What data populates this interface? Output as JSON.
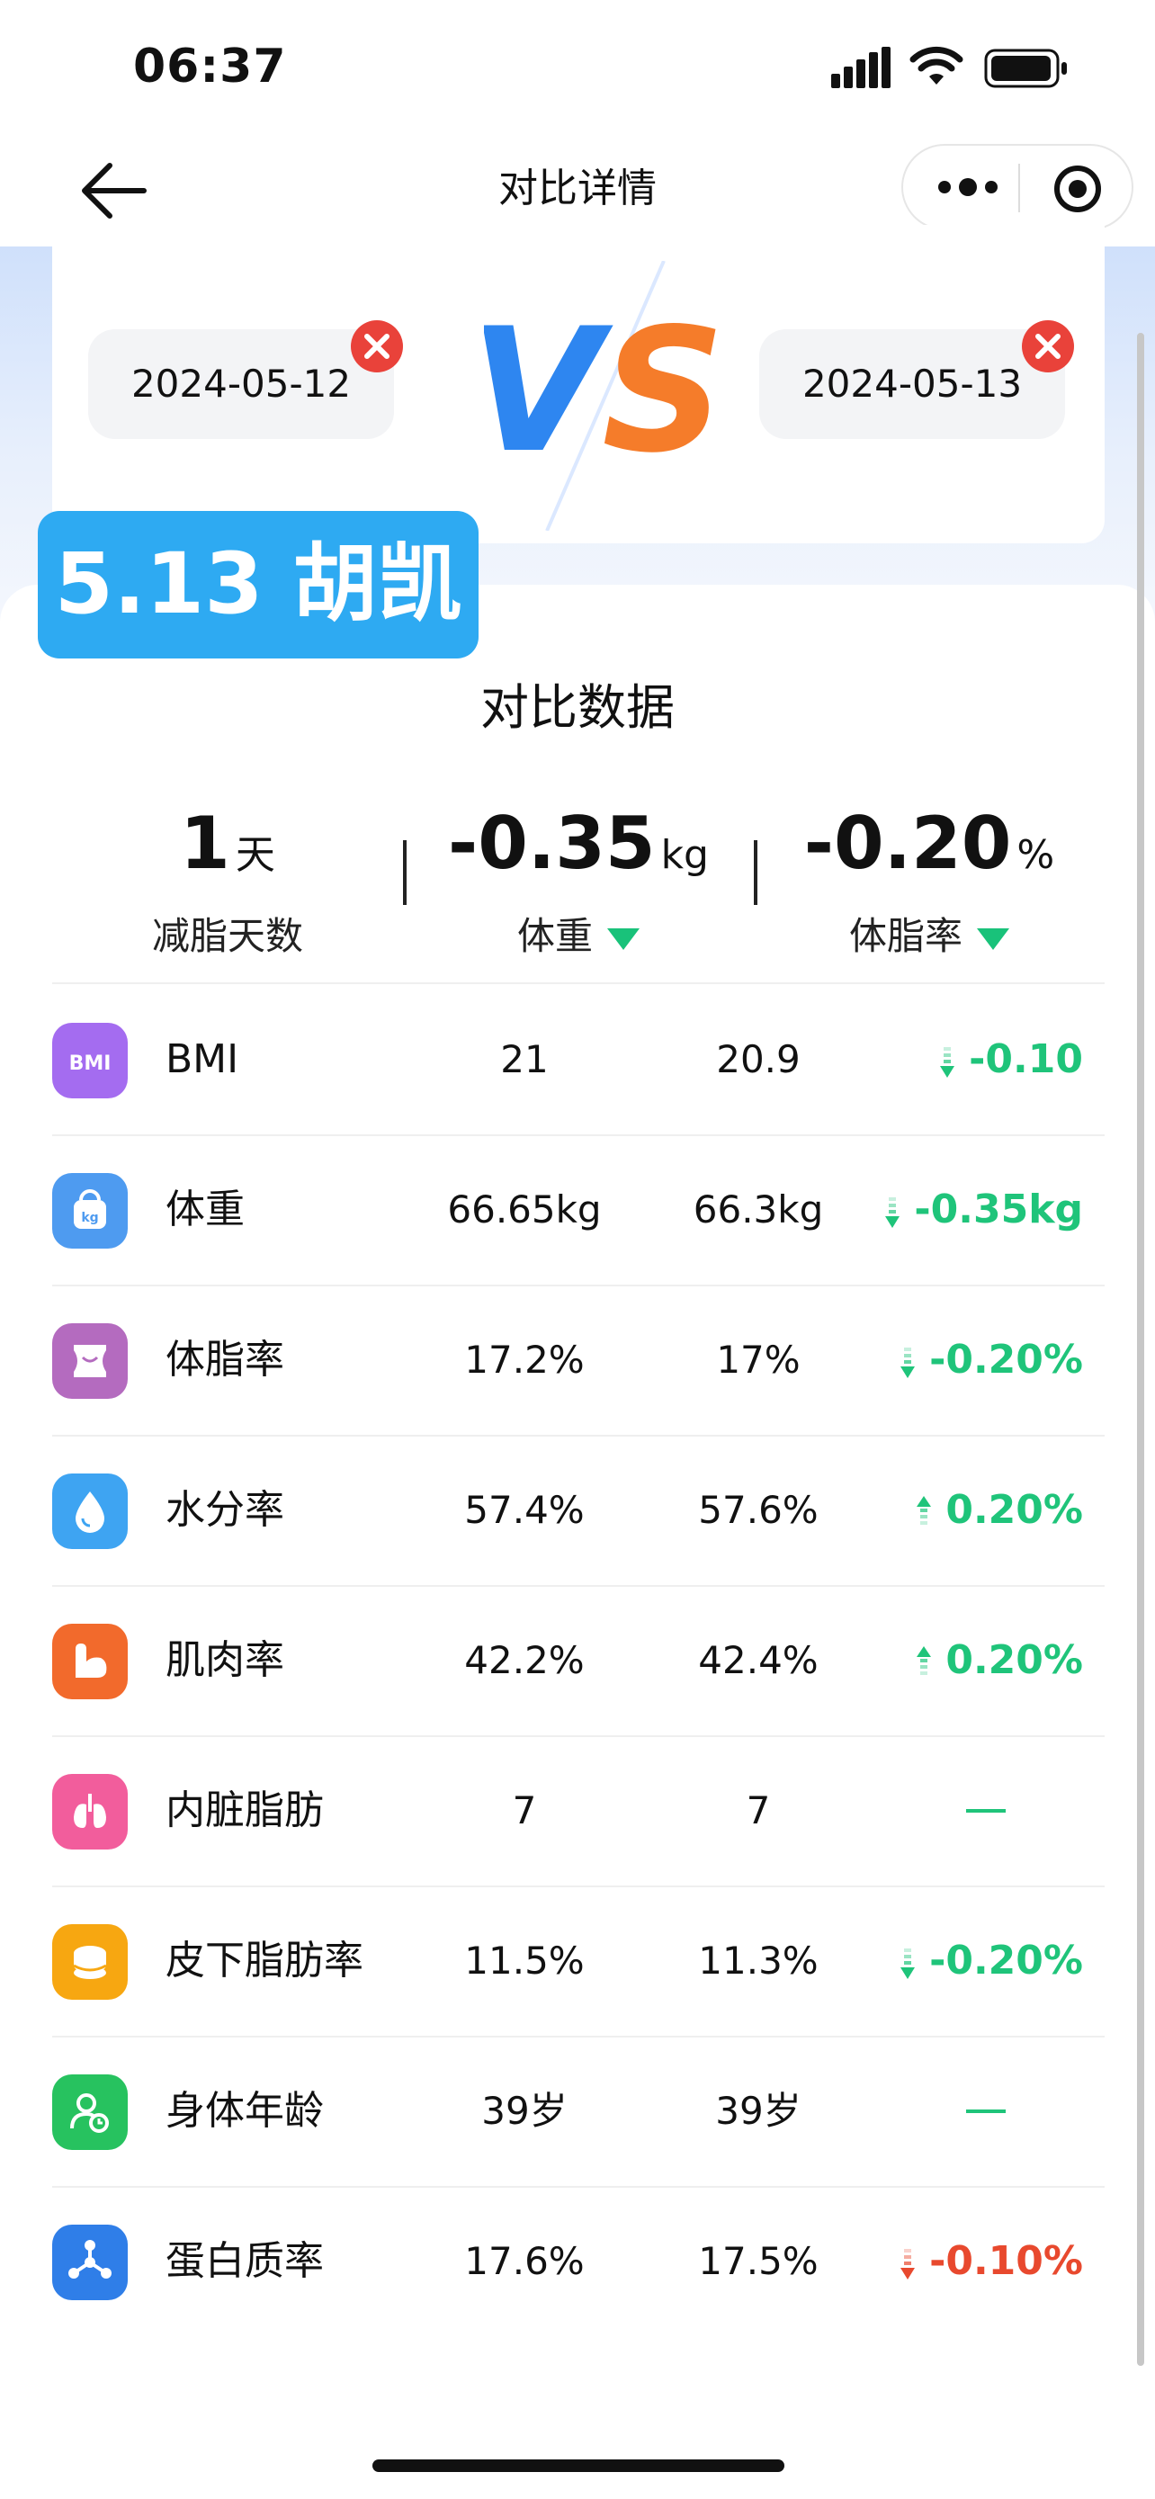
{
  "status_bar": {
    "time": "06:37"
  },
  "nav": {
    "title": "对比详情"
  },
  "compare": {
    "date_left": "2024-05-12",
    "date_right": "2024-05-13",
    "vs_text": "VS"
  },
  "overlay_tag": "5.13 胡凯",
  "section_title": "对比数据",
  "summary": [
    {
      "value": "1",
      "unit": "天",
      "label": "减脂天数",
      "trend": ""
    },
    {
      "value": "-0.35",
      "unit": "kg",
      "label": "体重",
      "trend": "down"
    },
    {
      "value": "-0.20",
      "unit": "%",
      "label": "体脂率",
      "trend": "down"
    }
  ],
  "rows": [
    {
      "icon": "bmi-icon",
      "color": "#a46cf0",
      "name": "BMI",
      "v1": "21",
      "v2": "20.9",
      "diff": "-0.10",
      "trend": "down",
      "diff_color": "green"
    },
    {
      "icon": "weight-kg-icon",
      "color": "#4e9bf0",
      "name": "体重",
      "v1": "66.65kg",
      "v2": "66.3kg",
      "diff": "-0.35kg",
      "trend": "down",
      "diff_color": "green"
    },
    {
      "icon": "body-fat-icon",
      "color": "#b46bbf",
      "name": "体脂率",
      "v1": "17.2%",
      "v2": "17%",
      "diff": "-0.20%",
      "trend": "down",
      "diff_color": "green"
    },
    {
      "icon": "water-drop-icon",
      "color": "#3ea4f2",
      "name": "水分率",
      "v1": "57.4%",
      "v2": "57.6%",
      "diff": "0.20%",
      "trend": "up",
      "diff_color": "green"
    },
    {
      "icon": "muscle-icon",
      "color": "#f26a2c",
      "name": "肌肉率",
      "v1": "42.2%",
      "v2": "42.4%",
      "diff": "0.20%",
      "trend": "up",
      "diff_color": "green"
    },
    {
      "icon": "lungs-icon",
      "color": "#f25d9c",
      "name": "内脏脂肪",
      "v1": "7",
      "v2": "7",
      "diff": "",
      "trend": "none",
      "diff_color": "green"
    },
    {
      "icon": "subcutaneous-fat-icon",
      "color": "#f7a711",
      "name": "皮下脂肪率",
      "v1": "11.5%",
      "v2": "11.3%",
      "diff": "-0.20%",
      "trend": "down",
      "diff_color": "green"
    },
    {
      "icon": "body-age-icon",
      "color": "#27c25f",
      "name": "身体年龄",
      "v1": "39岁",
      "v2": "39岁",
      "diff": "",
      "trend": "none",
      "diff_color": "green"
    },
    {
      "icon": "protein-icon",
      "color": "#2f7ee8",
      "name": "蛋白质率",
      "v1": "17.6%",
      "v2": "17.5%",
      "diff": "-0.10%",
      "trend": "down",
      "diff_color": "red"
    }
  ]
}
